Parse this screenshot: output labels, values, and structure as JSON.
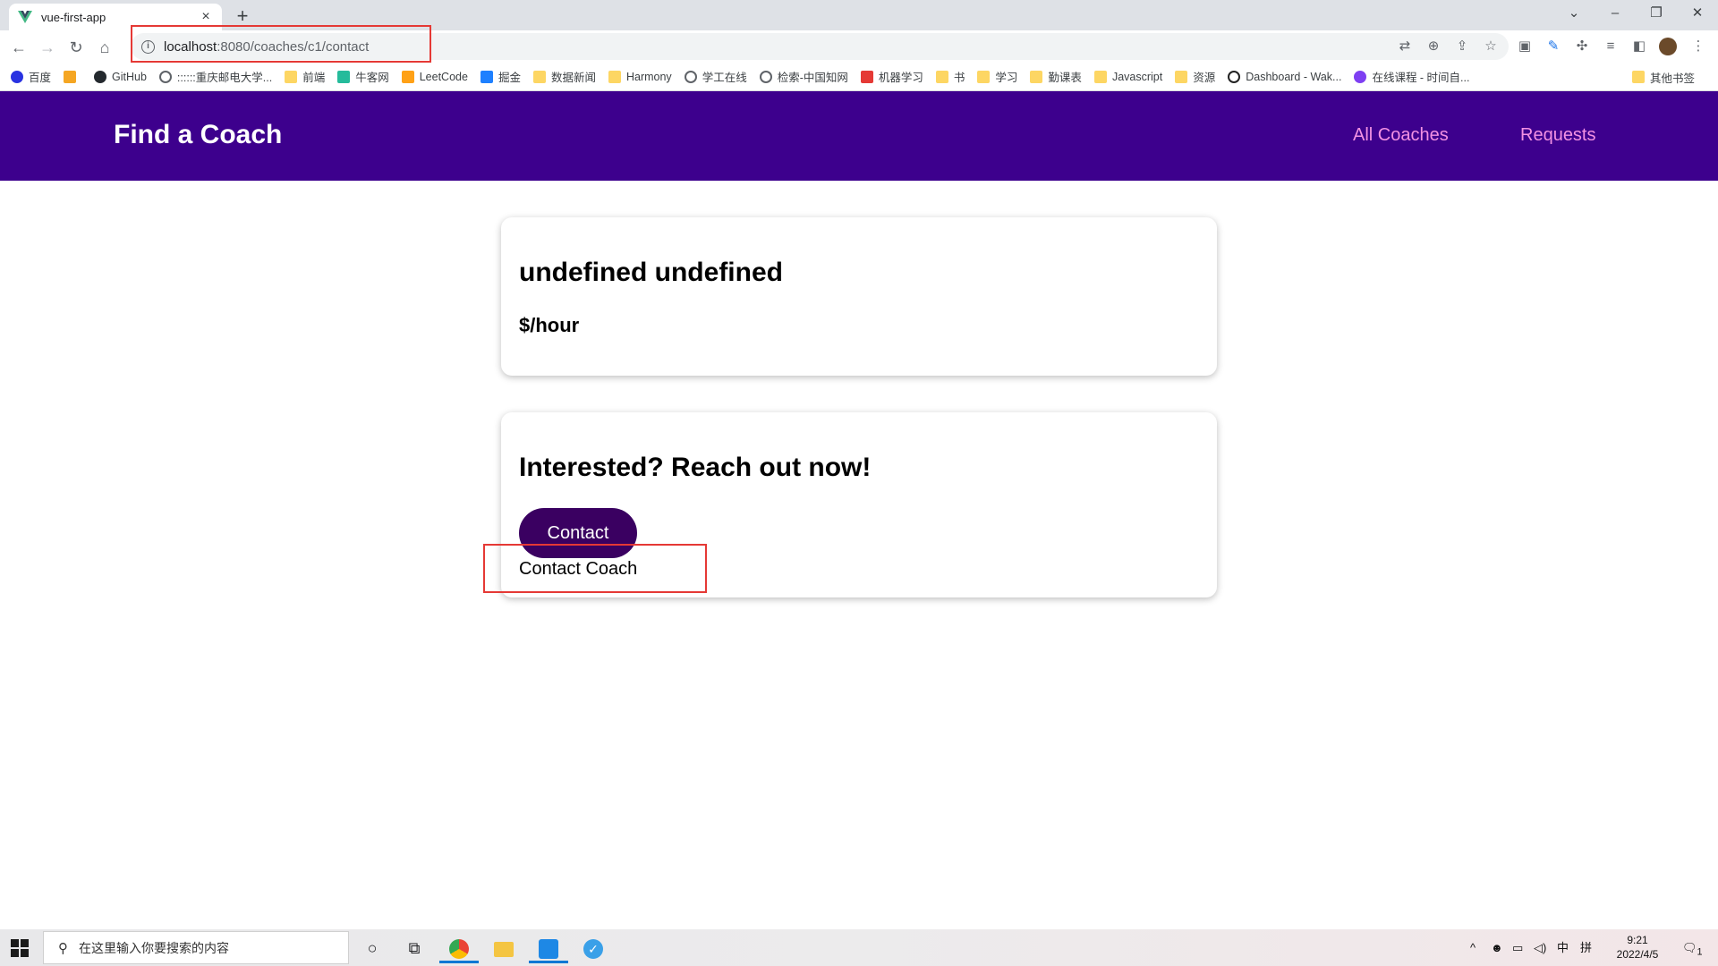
{
  "browser": {
    "tab_title": "vue-first-app",
    "url_host": "localhost",
    "url_path": ":8080/coaches/c1/contact",
    "bookmarks": [
      {
        "label": "百度",
        "icon": "baidu-icon"
      },
      {
        "label": "",
        "icon": "flame-icon"
      },
      {
        "label": "GitHub",
        "icon": "github-icon"
      },
      {
        "label": "::::::重庆邮电大学...",
        "icon": "globe-icon"
      },
      {
        "label": "前端",
        "icon": "folder-icon"
      },
      {
        "label": "牛客网",
        "icon": "nowcoder-icon"
      },
      {
        "label": "LeetCode",
        "icon": "leetcode-icon"
      },
      {
        "label": "掘金",
        "icon": "juejin-icon"
      },
      {
        "label": "数据新闻",
        "icon": "folder-icon"
      },
      {
        "label": "Harmony",
        "icon": "folder-icon"
      },
      {
        "label": "学工在线",
        "icon": "globe-icon"
      },
      {
        "label": "检索-中国知网",
        "icon": "globe-icon"
      },
      {
        "label": "机器学习",
        "icon": "ml-icon"
      },
      {
        "label": "书",
        "icon": "folder-icon"
      },
      {
        "label": "学习",
        "icon": "folder-icon"
      },
      {
        "label": "勤课表",
        "icon": "folder-icon"
      },
      {
        "label": "Javascript",
        "icon": "folder-icon"
      },
      {
        "label": "资源",
        "icon": "folder-icon"
      },
      {
        "label": "Dashboard - Wak...",
        "icon": "wakatime-icon"
      },
      {
        "label": "在线课程 - 时间自...",
        "icon": "course-icon"
      }
    ],
    "other_bookmarks": "其他书签"
  },
  "app": {
    "brand": "Find a Coach",
    "nav": {
      "all_coaches": "All Coaches",
      "requests": "Requests"
    },
    "coach_card": {
      "name": "undefined undefined",
      "rate": "$/hour"
    },
    "contact_card": {
      "heading": "Interested? Reach out now!",
      "button": "Contact",
      "link_text": "Contact Coach"
    }
  },
  "taskbar": {
    "search_placeholder": "在这里输入你要搜索的内容",
    "ime": "中",
    "ime2": "拼",
    "time": "9:21",
    "date": "2022/4/5",
    "notifications": "1"
  },
  "colors": {
    "header_bg": "#3d008d",
    "nav_link": "#f391e3",
    "button_bg": "#3a0061",
    "highlight_box": "#e53935"
  }
}
